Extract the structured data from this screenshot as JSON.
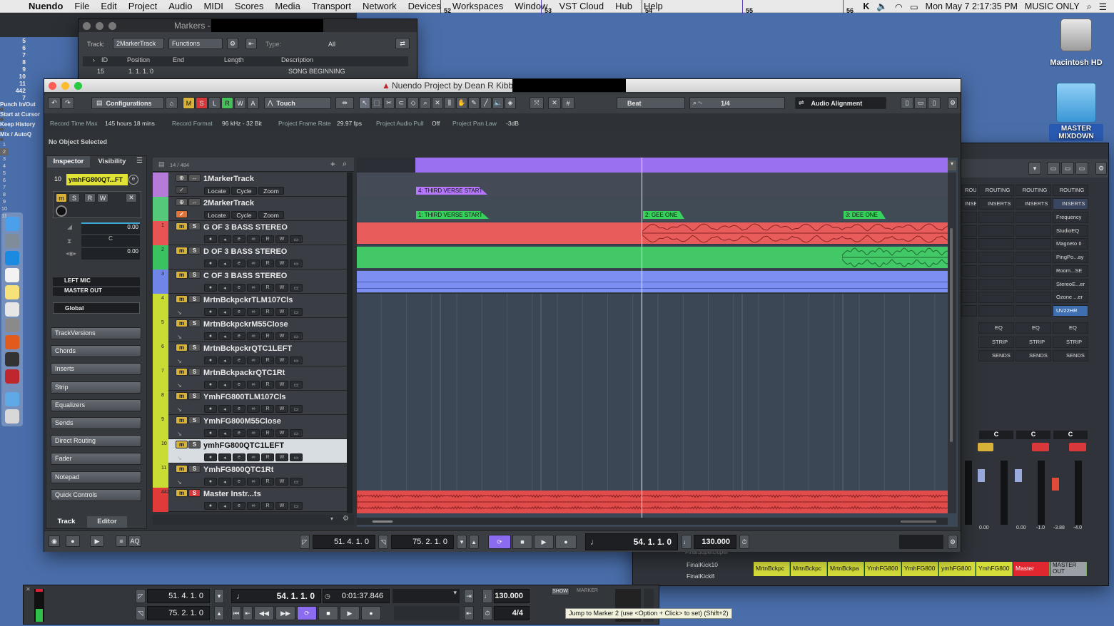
{
  "menubar": {
    "app": "Nuendo",
    "items": [
      "File",
      "Edit",
      "Project",
      "Audio",
      "MIDI",
      "Scores",
      "Media",
      "Transport",
      "Network",
      "Devices",
      "Workspaces",
      "Window",
      "VST Cloud",
      "Hub",
      "Help"
    ],
    "clock": "Mon May 7  2:17:35 PM",
    "user": "MUSIC ONLY"
  },
  "desktop": {
    "hd": "Macintosh HD",
    "folder": "MASTER MIXDOWN"
  },
  "markers_win": {
    "title": "Markers -",
    "track_label": "Track:",
    "track_value": "2MarkerTrack",
    "functions": "Functions",
    "type_label": "Type:",
    "type_value": "All",
    "columns": [
      "ID",
      "Position",
      "End",
      "Length",
      "Description"
    ],
    "row": {
      "id": "15",
      "position": "1. 1. 1.   0",
      "description": "SONG BEGINNING"
    }
  },
  "project": {
    "title": "Nuendo Project by Dean R Kibbe -",
    "configurations": "Configurations",
    "automation": "Touch",
    "snap": "Beat",
    "quantize": "1/4",
    "audio_alignment": "Audio Alignment",
    "msrwa": [
      "M",
      "S",
      "L",
      "R",
      "W",
      "A"
    ],
    "info": [
      {
        "k": "Record Time Max",
        "v": "145 hours 18 mins"
      },
      {
        "k": "Record Format",
        "v": "96 kHz - 32 Bit"
      },
      {
        "k": "Project Frame Rate",
        "v": "29.97 fps"
      },
      {
        "k": "Project Audio Pull",
        "v": "Off"
      },
      {
        "k": "Project Pan Law",
        "v": "-3dB"
      }
    ],
    "no_object": "No Object Selected"
  },
  "inspector": {
    "tabs": [
      "Inspector",
      "Visibility"
    ],
    "track_number": "10",
    "track_name": "ymhFG800QT...FT",
    "vol": "0.00",
    "pan": "C",
    "delay": "0.00",
    "input": "LEFT MIC",
    "output": "MASTER OUT",
    "global": "Global",
    "sections": [
      "TrackVersions",
      "Chords",
      "Inserts",
      "Strip",
      "Equalizers",
      "Sends",
      "Direct Routing",
      "Fader",
      "Notepad",
      "Quick Controls"
    ],
    "bottom_tabs": [
      "Track",
      "Editor"
    ]
  },
  "tracklist": {
    "count": "14 / 484",
    "locate": "Locate",
    "cycle": "Cycle",
    "zoom": "Zoom",
    "tracks": [
      {
        "num": "",
        "name": "1MarkerTrack",
        "color": "#b67ad8",
        "type": "marker"
      },
      {
        "num": "",
        "name": "2MarkerTrack",
        "color": "#54c97a",
        "type": "marker"
      },
      {
        "num": "1",
        "name": "G OF 3 BASS STEREO",
        "color": "#e85454",
        "type": "audio"
      },
      {
        "num": "2",
        "name": "D OF 3 BASS STEREO",
        "color": "#39c25f",
        "type": "audio"
      },
      {
        "num": "3",
        "name": "C OF 3 BASS STEREO",
        "color": "#6f86e8",
        "type": "audio"
      },
      {
        "num": "4",
        "name": "MrtnBckpckrTLM107Cls",
        "color": "#c9dc33",
        "type": "audio"
      },
      {
        "num": "5",
        "name": "MrtnBckpckrM55Close",
        "color": "#c9dc33",
        "type": "audio"
      },
      {
        "num": "6",
        "name": "MrtnBckpckrQTC1LEFT",
        "color": "#c9dc33",
        "type": "audio"
      },
      {
        "num": "7",
        "name": "MrtnBckpackrQTC1Rt",
        "color": "#c9dc33",
        "type": "audio"
      },
      {
        "num": "8",
        "name": "YmhFG800TLM107Cls",
        "color": "#c9dc33",
        "type": "audio"
      },
      {
        "num": "9",
        "name": "YmhFG800M55Close",
        "color": "#c9dc33",
        "type": "audio"
      },
      {
        "num": "10",
        "name": "ymhFG800QTC1LEFT",
        "color": "#c9dc33",
        "type": "audio",
        "selected": true
      },
      {
        "num": "11",
        "name": "YmhFG800QTC1Rt",
        "color": "#c9dc33",
        "type": "audio"
      },
      {
        "num": "442",
        "name": "Master              Instr...ts",
        "color": "#e03a3a",
        "type": "audio"
      }
    ]
  },
  "ruler": {
    "bars": [
      "52",
      "53",
      "54",
      "55",
      "56"
    ]
  },
  "markers": [
    {
      "label": "4: THIRD VERSE START",
      "lane": 0,
      "color": "#b678ff"
    },
    {
      "label": "1: THIRD VERSE START",
      "lane": 1,
      "color": "#37d25c"
    },
    {
      "label": "2: GEE ONE",
      "lane": 1,
      "color": "#37d25c"
    },
    {
      "label": "3: DEE ONE",
      "lane": 1,
      "color": "#37d25c"
    }
  ],
  "transport_bar": {
    "left": "51. 4. 1.   0",
    "right": "75. 2. 1.   0",
    "position": "54.  1.  1.    0",
    "tempo": "130.000",
    "aq": "AQ"
  },
  "mixer": {
    "routing": [
      "ROUTING",
      "ROUTING",
      "ROUTING",
      "ROUTING"
    ],
    "inserts_label": "INSERTS",
    "plugins": [
      "Frequency",
      "StudioEQ",
      "Magneto II",
      "PingPo...ay",
      "Room...SE",
      "StereoE...er",
      "Ozone ...er",
      "UV22HR"
    ],
    "eq": "EQ",
    "strip": "STRIP",
    "sends": "SENDS",
    "pans": [
      "C",
      "C",
      "C"
    ],
    "levels": [
      "0.00",
      "0.00",
      "-1.0",
      "-3.88",
      "-4.0"
    ],
    "channel_numbers": [
      "5",
      "6",
      "7",
      "8",
      "9",
      "10",
      "11",
      "442",
      "7"
    ],
    "channel_names": [
      "MrtnBckpc",
      "MrtnBckpc",
      "MrtnBckpa",
      "YmhFG800",
      "YmhFG800",
      "ymhFG800",
      "YmhFG800",
      "Master",
      "MASTER OUT"
    ],
    "list_items": [
      "FinalSuperDuper",
      "FinalKick10",
      "FinalKick8"
    ]
  },
  "transport_panel": {
    "options": [
      "Punch In/Out",
      "Start at Cursor",
      "Keep History",
      "Mix / AutoQ"
    ],
    "left": "51. 4. 1.   0",
    "right": "75. 2. 1.   0",
    "position": "54.  1.  1.    0",
    "time": "0:01:37.846",
    "tempo": "130.000",
    "signature": "4/4",
    "show": "SHOW",
    "marker": "MARKER",
    "marker_nums": [
      "1",
      "2",
      "3",
      "4",
      "5",
      "6",
      "7",
      "8",
      "9",
      "10",
      "11"
    ],
    "tooltip": "Jump to Marker 2 (use <Option + Click> to set) (Shift+2)"
  }
}
